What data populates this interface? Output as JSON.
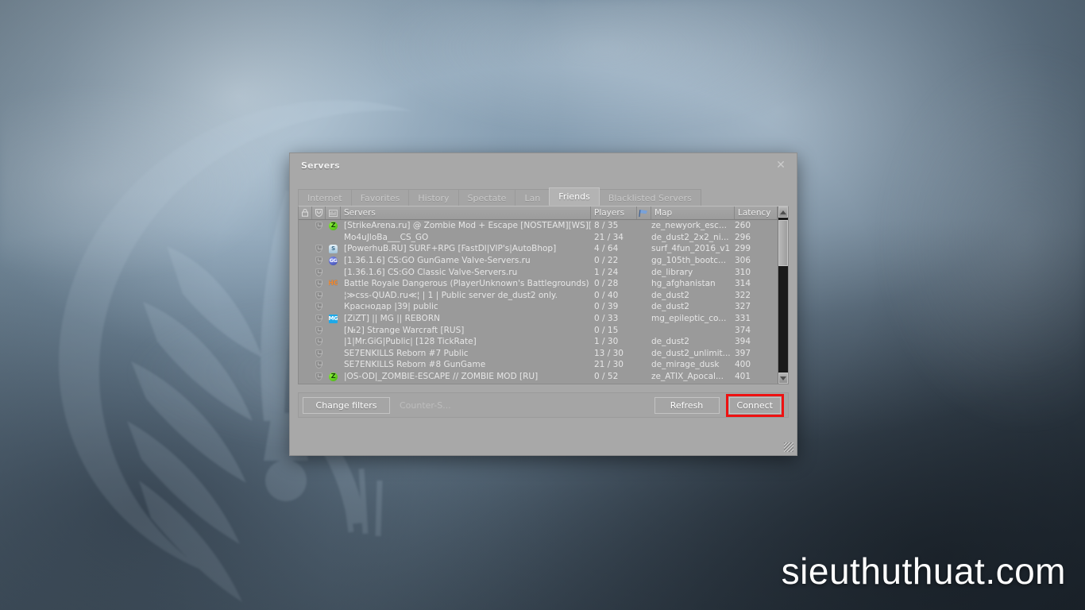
{
  "watermark": {
    "text": "sieuthuthuat.com"
  },
  "window": {
    "title": "Servers",
    "close_icon": "close-icon",
    "resize_grip_icon": "resize-grip-icon"
  },
  "tabs": [
    {
      "label": "Internet",
      "active": false
    },
    {
      "label": "Favorites",
      "active": false
    },
    {
      "label": "History",
      "active": false
    },
    {
      "label": "Spectate",
      "active": false
    },
    {
      "label": "Lan",
      "active": false
    },
    {
      "label": "Friends",
      "active": true
    },
    {
      "label": "Blacklisted Servers",
      "active": false
    }
  ],
  "columns": {
    "lock_icon": "lock-icon",
    "shield_icon": "shield-icon",
    "vac_icon": "vac-icon",
    "servers": "Servers",
    "players": "Players",
    "flag_icon": "map-flag-icon",
    "map": "Map",
    "latency": "Latency"
  },
  "servers": [
    {
      "secure": true,
      "badge": "Z",
      "badge_type": "z",
      "name": "[StrikeArena.ru] @ Zombie Mod + Escape [NOSTEAM][WS][KNIFE]",
      "players": "8 / 35",
      "map": "ze_newyork_esc...",
      "latency": "260"
    },
    {
      "secure": false,
      "badge": "",
      "badge_type": "",
      "name": "Mo4uJloBa___CS_GO",
      "players": "21 / 34",
      "map": "de_dust2_2x2_ni...",
      "latency": "296"
    },
    {
      "secure": true,
      "badge": "S",
      "badge_type": "surf",
      "name": "[PowerhuB.RU] SURF+RPG [FastDl|VIP's|AutoBhop]",
      "players": "4 / 64",
      "map": "surf_4fun_2016_v1",
      "latency": "299"
    },
    {
      "secure": true,
      "badge": "GG",
      "badge_type": "gg",
      "name": "[1.36.1.6] CS:GO GunGame Valve-Servers.ru",
      "players": "0 / 22",
      "map": "gg_105th_bootc...",
      "latency": "306"
    },
    {
      "secure": true,
      "badge": "",
      "badge_type": "",
      "name": "[1.36.1.6] CS:GO Classic Valve-Servers.ru",
      "players": "1 / 24",
      "map": "de_library",
      "latency": "310"
    },
    {
      "secure": true,
      "badge": "HG",
      "badge_type": "hg",
      "name": "Battle Royale Dangerous (PlayerUnknown's Battlegrounds)",
      "players": "0 / 28",
      "map": "hg_afghanistan",
      "latency": "314"
    },
    {
      "secure": true,
      "badge": "",
      "badge_type": "",
      "name": "¦≫css-QUAD.ru≪¦ | 1 | Public server de_dust2 only.",
      "players": "0 / 40",
      "map": "de_dust2",
      "latency": "322"
    },
    {
      "secure": true,
      "badge": "",
      "badge_type": "",
      "name": "Краснодар |39| public",
      "players": "0 / 39",
      "map": "de_dust2",
      "latency": "327"
    },
    {
      "secure": true,
      "badge": "MG",
      "badge_type": "mg",
      "name": "[ZiZT] || MG || REBORN",
      "players": "0 / 33",
      "map": "mg_epileptic_co...",
      "latency": "331"
    },
    {
      "secure": true,
      "badge": "",
      "badge_type": "",
      "name": "[№2] Strange Warcraft [RUS]",
      "players": "0 / 15",
      "map": "",
      "latency": "374"
    },
    {
      "secure": true,
      "badge": "",
      "badge_type": "",
      "name": "|1|Mr.GiG|Public| [128 TickRate]",
      "players": "1 / 30",
      "map": "de_dust2",
      "latency": "394"
    },
    {
      "secure": true,
      "badge": "",
      "badge_type": "",
      "name": "SE7ENKILLS Reborn #7 Public",
      "players": "13 / 30",
      "map": "de_dust2_unlimit...",
      "latency": "397"
    },
    {
      "secure": true,
      "badge": "",
      "badge_type": "",
      "name": "SE7ENKILLS Reborn #8 GunGame",
      "players": "21 / 30",
      "map": "de_mirage_dusk",
      "latency": "400"
    },
    {
      "secure": true,
      "badge": "Z",
      "badge_type": "z",
      "name": "|OS-OD|_ZOMBIE-ESCAPE // ZOMBIE MOD [RU]",
      "players": "0 / 52",
      "map": "ze_ATIX_Apocal...",
      "latency": "401"
    }
  ],
  "scrollbar": {
    "up_icon": "scroll-up-arrow-icon",
    "down_icon": "scroll-down-arrow-icon"
  },
  "bottom_bar": {
    "change_filters": "Change filters",
    "filter_summary": "Counter-S...",
    "refresh": "Refresh",
    "connect": "Connect",
    "connect_highlight_color": "#ee1111"
  }
}
